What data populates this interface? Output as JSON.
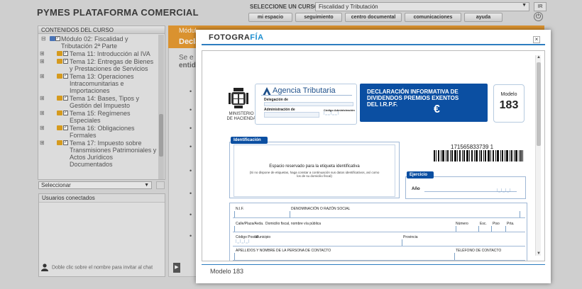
{
  "header": {
    "brand": "PYMES PLATAFORMA COMERCIAL",
    "course_label": "SELECCIONE UN CURSO:",
    "course_value": "Fiscalidad y Tributación",
    "go_label": "IR",
    "nav": [
      "mi espacio",
      "seguimiento",
      "centro documental",
      "comunicaciones",
      "ayuda"
    ]
  },
  "sidebar": {
    "title": "CONTENIDOS DEL CURSO",
    "items": [
      "Módulo 02: Fiscalidad y Tributación 2ª Parte",
      "Tema 11: Introducción al IVA",
      "Tema 12: Entregas de Bienes y Prestaciones de Servicios",
      "Tema 13: Operaciones Intracomunitarias e Importaciones",
      "Tema 14: Bases, Tipos y Gestión del Impuesto",
      "Tema 15: Regímenes Especiales",
      "Tema 16: Obligaciones Formales",
      "Tema 17: Impuesto sobre Transmisiones Patrimoniales y Actos Jurídicos Documentados"
    ],
    "select_label": "Seleccionar",
    "users_title": "Usuarios conectados",
    "chat_hint": "Doble clic sobre el nombre para invitar al chat"
  },
  "main": {
    "module_label": "Módul",
    "module_title": "Declar",
    "para_line1": "Se e",
    "para_line2": "entid"
  },
  "modal": {
    "logo_part1": "FOTOGRA",
    "logo_part2": "FÍA",
    "close": "×",
    "caption": "Modelo 183",
    "form": {
      "ministry": "MINISTERIO DE HACIENDA",
      "agency": "Agencia Tributaria",
      "delegacion": "Delegación de",
      "administracion": "Administración de",
      "codigo_admin": "Código Administración",
      "decl_title": "DECLARACIÓN INFORMATIVA DE DIVIDENDOS PREMIOS EXENTOS DEL I.R.P.F.",
      "euro": "€",
      "modelo_label": "Modelo",
      "modelo_num": "183",
      "ident_header": "Identificación",
      "ident_main": "Espacio reservado para la etiqueta identificativa",
      "ident_note": "(Si no dispone de etiquetas, haga constar a continuación sus datos identificativos, así como los de su domicilio fiscal)",
      "barcode_number": "171565833739 1",
      "ejercicio_header": "Ejercicio",
      "anio": "Año",
      "nif": "N.I.F.",
      "denominacion": "DENOMINACIÓN O RAZÓN SOCIAL",
      "calle": "Calle/Plaza/Avda.",
      "domicilio": "Domicilio fiscal, nombre vía pública",
      "numero": "Número",
      "esc": "Esc.",
      "piso": "Piso",
      "prta": "Prta.",
      "codigo_postal": "Código Postal",
      "municipio": "Municipio",
      "provincia": "Provincia",
      "apellidos": "APELLIDOS Y NOMBRE DE LA PERSONA DE CONTACTO",
      "telefono": "TELÉFONO DE CONTACTO"
    }
  }
}
